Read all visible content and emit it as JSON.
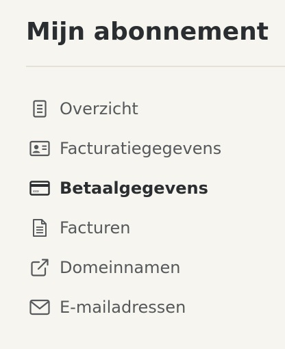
{
  "page": {
    "title": "Mijn abonnement"
  },
  "menu": {
    "items": [
      {
        "label": "Overzicht",
        "icon": "document-icon",
        "active": false
      },
      {
        "label": "Facturatiegegevens",
        "icon": "id-card-icon",
        "active": false
      },
      {
        "label": "Betaalgegevens",
        "icon": "credit-card-icon",
        "active": true
      },
      {
        "label": "Facturen",
        "icon": "invoice-file-icon",
        "active": false
      },
      {
        "label": "Domeinnamen",
        "icon": "external-link-icon",
        "active": false
      },
      {
        "label": "E-mailadressen",
        "icon": "envelope-icon",
        "active": false
      }
    ]
  },
  "colors": {
    "background": "#f6f5ef",
    "text_active": "#2b2e30",
    "text_inactive": "#56595b",
    "divider": "#e3e1d8"
  }
}
